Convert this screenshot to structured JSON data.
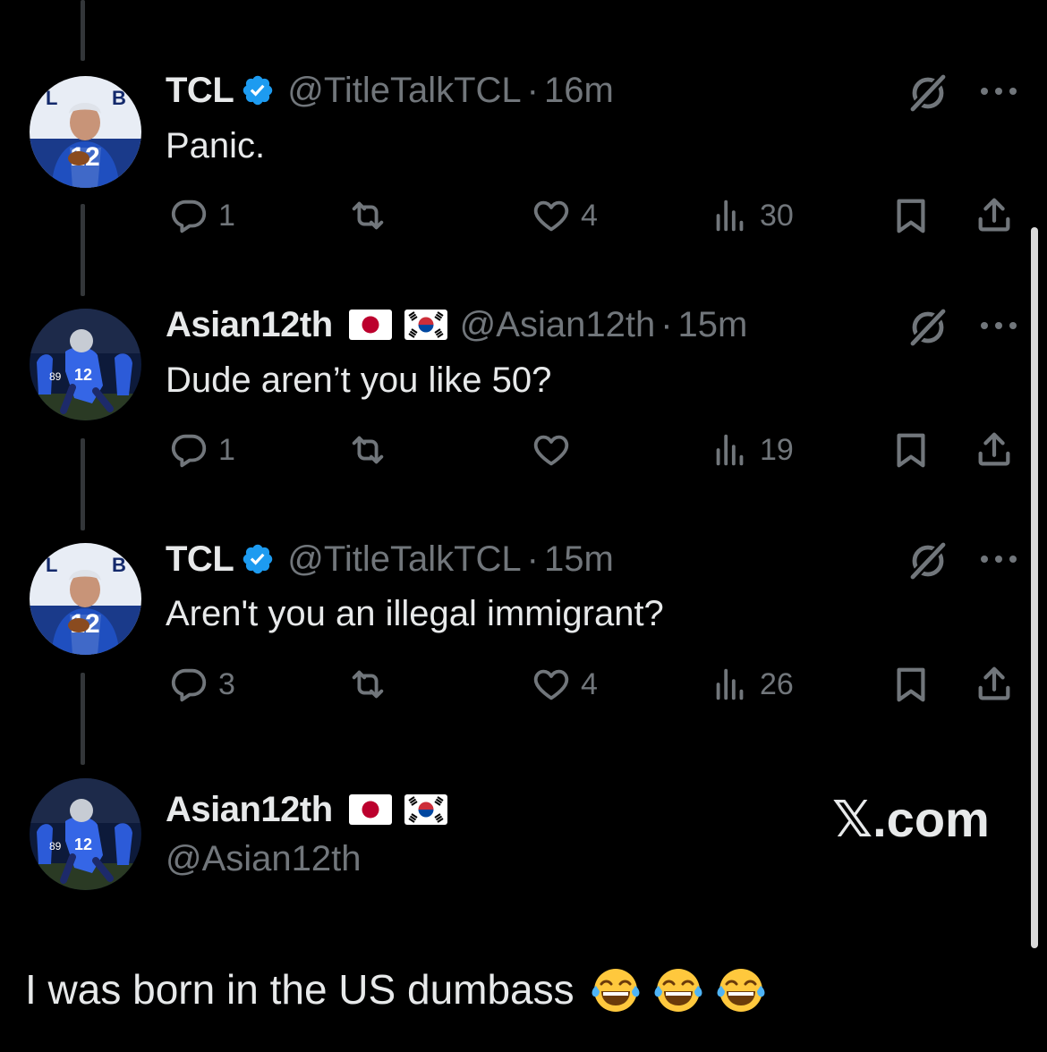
{
  "colors": {
    "background": "#000000",
    "text_primary": "#e7e9ea",
    "text_secondary": "#71767b",
    "verified": "#1d9bf0",
    "thread_line": "#333639"
  },
  "tweets": [
    {
      "display_name": "TCL",
      "verified": true,
      "flags": [],
      "handle": "@TitleTalkTCL",
      "separator": "·",
      "time": "16m",
      "text": "Panic.",
      "reply_count": "1",
      "repost_count": "",
      "like_count": "4",
      "view_count": "30"
    },
    {
      "display_name": "Asian12th",
      "verified": false,
      "flags": [
        "japan-flag-icon",
        "south-korea-flag-icon"
      ],
      "handle": "@Asian12th",
      "separator": "·",
      "time": "15m",
      "text": "Dude aren’t you like 50?",
      "reply_count": "1",
      "repost_count": "",
      "like_count": "",
      "view_count": "19"
    },
    {
      "display_name": "TCL",
      "verified": true,
      "flags": [],
      "handle": "@TitleTalkTCL",
      "separator": "·",
      "time": "15m",
      "text": "Aren't you an illegal immigrant?",
      "reply_count": "3",
      "repost_count": "",
      "like_count": "4",
      "view_count": "26"
    }
  ],
  "composer": {
    "display_name": "Asian12th",
    "handle": "@Asian12th",
    "flags": [
      "japan-flag-icon",
      "south-korea-flag-icon"
    ]
  },
  "watermark": "𝕏.com",
  "caption": {
    "text": "I was born in the US dumbass",
    "emojis": [
      "tears-of-joy-emoji",
      "tears-of-joy-emoji",
      "tears-of-joy-emoji"
    ]
  }
}
